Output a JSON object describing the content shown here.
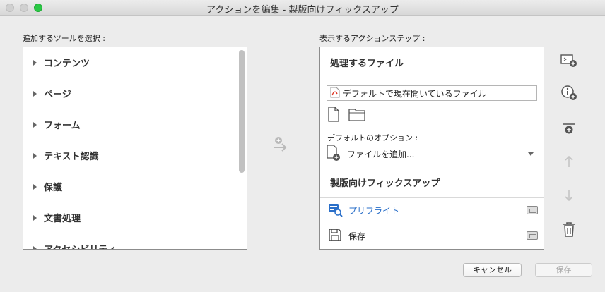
{
  "window": {
    "title": "アクションを編集 - 製版向けフィックスアップ"
  },
  "tools": {
    "label": "追加するツールを選択 :",
    "items": [
      "コンテンツ",
      "ページ",
      "フォーム",
      "テキスト認識",
      "保護",
      "文書処理",
      "アクセシビリティ"
    ]
  },
  "steps": {
    "label": "表示するアクションステップ :",
    "files_header": "処理するファイル",
    "default_file": "デフォルトで現在開いているファイル",
    "default_options_label": "デフォルトのオプション :",
    "add_file_option": "ファイルを追加...",
    "group_header": "製版向けフィックスアップ",
    "actions": [
      {
        "label": "プリフライト",
        "highlight": true
      },
      {
        "label": "保存",
        "highlight": false
      }
    ]
  },
  "buttons": {
    "cancel": "キャンセル",
    "save": "保存"
  },
  "colors": {
    "accent": "#2a6fc9",
    "zoom": "#2ac845"
  }
}
